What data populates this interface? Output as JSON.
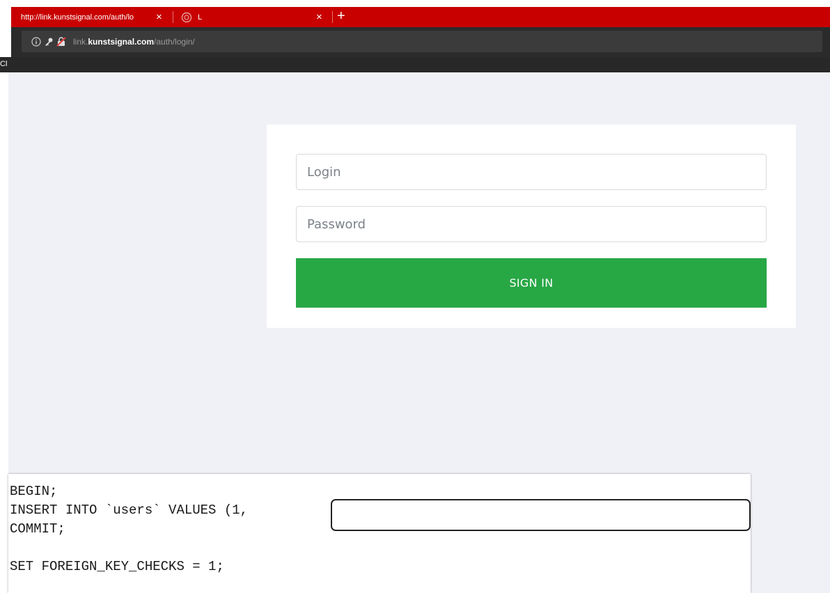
{
  "browser": {
    "tabs": [
      {
        "title": "http://link.kunstsignal.com/auth/lo",
        "title_fade": "",
        "active": true
      },
      {
        "title": "L",
        "active": false
      }
    ],
    "tab_close_glyph": "×",
    "new_tab_glyph": "+",
    "url": {
      "prefix": "link.",
      "host": "kunstsignal.com",
      "path": "/auth/login/"
    },
    "bookmarks_label": "Cl",
    "icons": {
      "info": "info-icon",
      "key": "key-icon",
      "insecure": "insecure-lock-icon"
    },
    "colors": {
      "tabbar": "#c80000",
      "toolbar": "#2b2b2b"
    }
  },
  "login": {
    "login_placeholder": "Login",
    "password_placeholder": "Password",
    "signin_label": "SIGN IN",
    "colors": {
      "signin": "#28a745",
      "page_bg": "#f0f1f6"
    }
  },
  "sql": {
    "lines": [
      "BEGIN;",
      "INSERT INTO `users` VALUES (1,",
      "COMMIT;",
      "SET FOREIGN_KEY_CHECKS = 1;"
    ]
  }
}
